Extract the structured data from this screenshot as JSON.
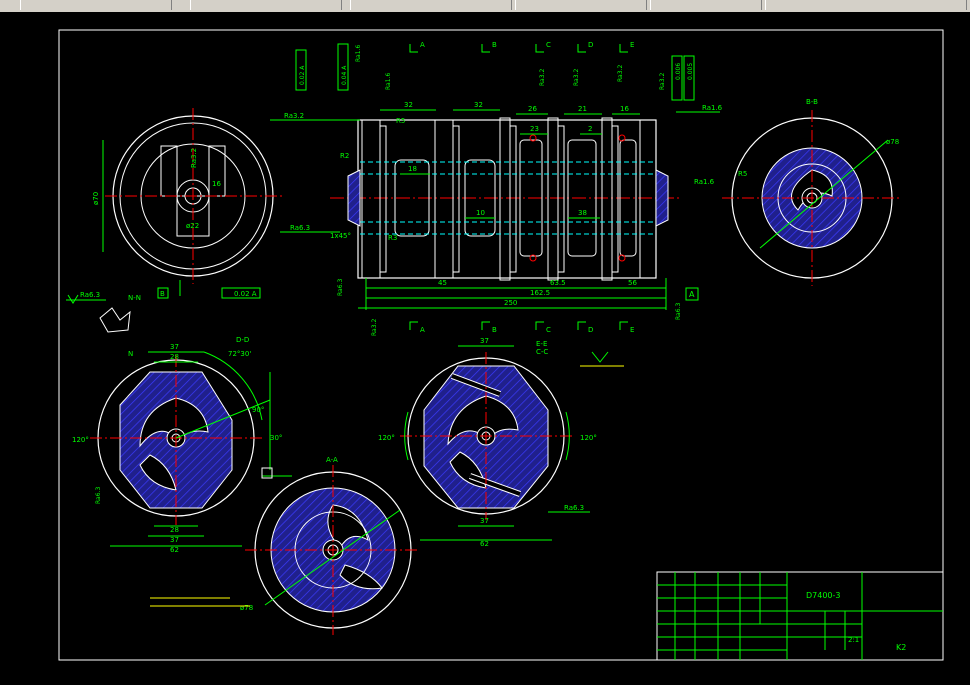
{
  "drawing": {
    "number": "D7400-3",
    "scale": "2:1",
    "sheet_code": "K2"
  },
  "section_labels": {
    "a": "A",
    "b": "B",
    "c": "C",
    "d": "D",
    "e": "E",
    "bb": "B-B",
    "dd": "D-D",
    "ee": "E-E",
    "cc": "C-C",
    "aa": "A-A",
    "nn": "N-N",
    "n": "N"
  },
  "dimensions": {
    "d32a": "32",
    "d32b": "32",
    "d26": "26",
    "d21": "21",
    "d16": "16",
    "d23": "23",
    "d2": "2",
    "d18": "18",
    "d10": "10",
    "d38": "38",
    "d45": "45",
    "d635": "63.5",
    "d56": "56",
    "d1625": "162.5",
    "d250": "250",
    "d37a": "37",
    "d28a": "28",
    "d28b": "28",
    "d37b": "37",
    "d62a": "62",
    "d37c": "37",
    "d37d": "37",
    "d62b": "62",
    "d78a": "ø78",
    "d78b": "ø78",
    "d70": "ø70",
    "d22": "ø22",
    "a120a": "120°",
    "a120b": "120°",
    "a120c": "120°",
    "a120d": "120°",
    "a7230": "72°30'",
    "a90": "90°",
    "a30": "30°",
    "cham": "1x45°"
  },
  "roughness": {
    "r1": "Ra3.2",
    "r2": "Ra1.6",
    "r3": "Ra6.3",
    "r4": "Ra1.6",
    "r5": "Ra3.2",
    "r6": "Ra3.2",
    "r7": "Ra3.2",
    "r8": "Ra6.3",
    "r9": "Ra6.3",
    "r10": "Ra3.2",
    "r11": "Ra1.6",
    "r12": "Ra3.2",
    "r13": "Ra6.3",
    "r14": "Ra1.6",
    "r15": "Ra3.2"
  },
  "tolerance": {
    "t1": "0.02 A",
    "t2": "0.04 A",
    "t3": "0.02 A",
    "t4": "0.006",
    "t5": "0.005"
  },
  "radii": {
    "r5a": "R5",
    "r2": "R2",
    "r3": "R3",
    "r5b": "R5"
  },
  "datum": {
    "a": "A",
    "b": "B"
  },
  "colors": {
    "white": "#ffffff",
    "green": "#00ff00",
    "red": "#ff0000",
    "cyan": "#00ffff",
    "blue": "#2020c0",
    "yellow": "#ffff00",
    "border": "#ffffff"
  }
}
